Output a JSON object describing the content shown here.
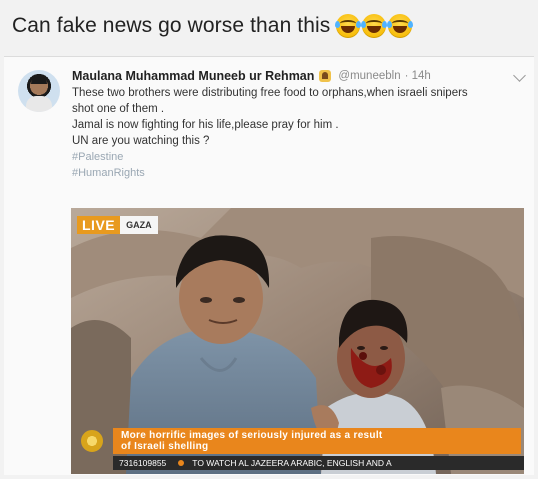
{
  "caption": {
    "text": "Can fake news go worse than this",
    "emojis": [
      "joy-emoji",
      "joy-emoji",
      "joy-emoji"
    ]
  },
  "tweet": {
    "display_name": "Maulana Muhammad Muneeb ur Rehman",
    "badge_icon": "flag-badge-icon",
    "handle": "@muneebln",
    "time": "· 14h",
    "lines": [
      "These two brothers were distributing free food to orphans,when israeli snipers",
      "shot one of them .",
      "Jamal is now fighting for his life,please pray for him .",
      "UN are you watching this ?"
    ],
    "hashtags": [
      "#Palestine",
      "#HumanRights"
    ],
    "menu_icon": "chevron-down-icon"
  },
  "media": {
    "live_label": "LIVE",
    "location_label": "GAZA",
    "headline_line1": "More horrific images of seriously injured as a result",
    "headline_line2": "of Israeli shelling",
    "ticker_phone": "7316109855",
    "ticker_text": "TO WATCH AL JAZEERA ARABIC, ENGLISH AND A",
    "logo_icon": "al-jazeera-logo-icon",
    "colors": {
      "accent_orange": "#e9861c",
      "live_orange": "#e89a1f",
      "ticker_dark": "#2a2a2a"
    }
  }
}
